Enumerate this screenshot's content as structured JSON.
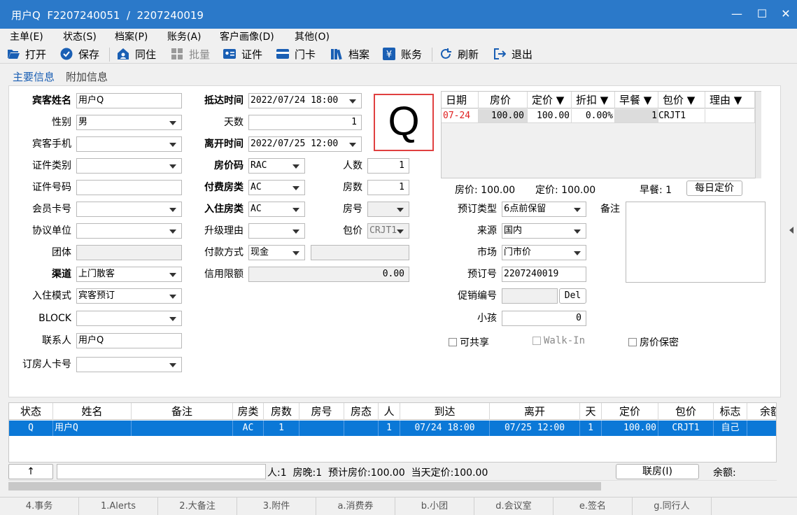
{
  "window": {
    "title": "用户Q  F2207240051  /  2207240019",
    "min": "—",
    "max": "☐",
    "close": "✕"
  },
  "menu": [
    "主单(E)",
    "状态(S)",
    "档案(P)",
    "账务(A)",
    "客户画像(D)",
    "其他(O)"
  ],
  "toolbar": {
    "open": "打开",
    "save": "保存",
    "cohabit": "同住",
    "batch": "批量",
    "id_card": "证件",
    "door_card": "门卡",
    "archive": "档案",
    "account": "账务",
    "refresh": "刷新",
    "exit": "退出"
  },
  "tabs": {
    "main": "主要信息",
    "extra": "附加信息"
  },
  "form": {
    "guest_name_label": "宾客姓名",
    "guest_name": "用户Q",
    "gender_label": "性别",
    "gender": "男",
    "phone_label": "宾客手机",
    "phone": "",
    "id_type_label": "证件类别",
    "id_type": "",
    "id_no_label": "证件号码",
    "id_no": "",
    "member_label": "会员卡号",
    "member": "",
    "agreement_label": "协议单位",
    "agreement": "",
    "group_label": "团体",
    "group": "",
    "channel_label": "渠道",
    "channel": "上门散客",
    "checkin_mode_label": "入住模式",
    "checkin_mode": "宾客预订",
    "block_label": "BLOCK",
    "block": "",
    "contact_label": "联系人",
    "contact": "用户Q",
    "booker_card_label": "订房人卡号",
    "booker_card": "",
    "arrival_label": "抵达时间",
    "arrival": "2022/07/24 18:00",
    "days_label": "天数",
    "days": "1",
    "departure_label": "离开时间",
    "departure": "2022/07/25 12:00",
    "rate_code_label": "房价码",
    "rate_code": "RAC",
    "persons_label": "人数",
    "persons": "1",
    "pay_room_label": "付费房类",
    "pay_room": "AC",
    "rooms_label": "房数",
    "rooms": "1",
    "checkin_room_label": "入住房类",
    "checkin_room": "AC",
    "room_no_label": "房号",
    "room_no": "",
    "upgrade_label": "升级理由",
    "upgrade": "",
    "package_label": "包价",
    "package": "CRJT1",
    "pay_method_label": "付款方式",
    "pay_method": "现金",
    "pay_extra": "",
    "credit_label": "信用限额",
    "credit": "0.00",
    "status_letter": "Q",
    "booking_type_label": "预订类型",
    "booking_type": "6点前保留",
    "remark_label": "备注",
    "remark": "",
    "source_label": "来源",
    "source": "国内",
    "market_label": "市场",
    "market": "门市价",
    "booking_no_label": "预订号",
    "booking_no": "2207240019",
    "promo_label": "促销编号",
    "promo": "",
    "del": "Del",
    "child_label": "小孩",
    "child": "0",
    "shareable": "可共享",
    "walkin": "Walk-In",
    "rate_secret": "房价保密"
  },
  "rate_grid": {
    "headers": [
      "日期",
      "房价",
      "定价 ▼",
      "折扣 ▼",
      "早餐 ▼",
      "包价 ▼",
      "理由 ▼"
    ],
    "row": [
      "07-24",
      "100.00",
      "100.00",
      "0.00%",
      "1",
      "CRJT1",
      ""
    ],
    "summary": {
      "room_rate": "房价: 100.00",
      "set_rate": "定价: 100.00",
      "breakfast": "早餐: 1",
      "daily_btn": "每日定价"
    }
  },
  "list": {
    "headers": [
      "状态",
      "姓名",
      "备注",
      "房类",
      "房数",
      "房号",
      "房态",
      "人",
      "到达",
      "离开",
      "天",
      "定价",
      "包价",
      "标志",
      "余额"
    ],
    "row": [
      "Q",
      "用户Q",
      "",
      "AC",
      "1",
      "",
      "",
      "1",
      "07/24 18:00",
      "07/25 12:00",
      "1",
      "100.00",
      "CRJT1",
      "自己",
      ""
    ]
  },
  "status": {
    "up": "↑",
    "summary": "人:1  房晚:1  预计房价:100.00  当天定价:100.00",
    "link_btn": "联房(I)",
    "balance": "余额:"
  },
  "bottom_tabs": [
    "4.事务",
    "1.Alerts",
    "2.大备注",
    "3.附件",
    "a.消费券",
    "b.小团",
    "d.会议室",
    "e.签名",
    "g.同行人"
  ],
  "colors": {
    "titlebar": "#2b79c9",
    "selected_row": "#0b78d7",
    "accent": "#1a5fb4",
    "qbox_border": "#e04040"
  }
}
